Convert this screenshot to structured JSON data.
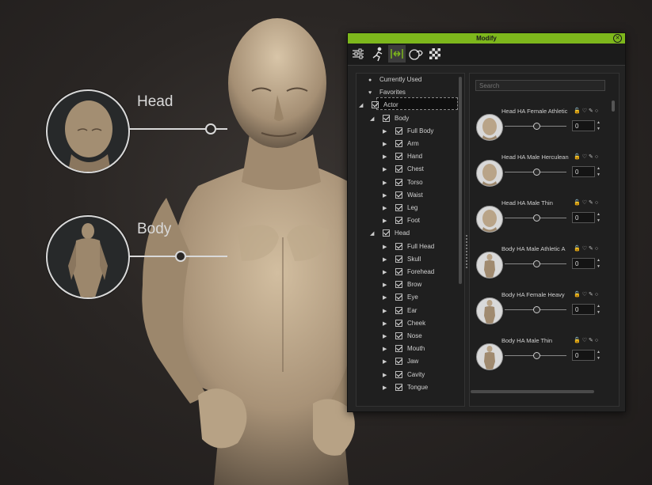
{
  "window": {
    "title": "Modify"
  },
  "toolbar": {
    "tools": [
      {
        "name": "sliders-icon",
        "active": false
      },
      {
        "name": "motion-icon",
        "active": false
      },
      {
        "name": "morph-icon",
        "active": true
      },
      {
        "name": "face-icon",
        "active": false
      },
      {
        "name": "checker-icon",
        "active": false
      }
    ]
  },
  "callouts": [
    {
      "label": "Head"
    },
    {
      "label": "Body"
    }
  ],
  "tree": {
    "items": [
      {
        "label": "Currently Used",
        "marker": "●",
        "indent": 0,
        "triangle": "",
        "checkbox": false
      },
      {
        "label": "Favorites",
        "marker": "♥",
        "indent": 0,
        "triangle": "",
        "checkbox": false
      },
      {
        "label": "Actor",
        "indent": 1,
        "triangle": "◢",
        "checkbox": true
      },
      {
        "label": "Body",
        "indent": 2,
        "triangle": "◢",
        "checkbox": true
      },
      {
        "label": "Full Body",
        "indent": 3,
        "triangle": "▶",
        "checkbox": true
      },
      {
        "label": "Arm",
        "indent": 3,
        "triangle": "▶",
        "checkbox": true
      },
      {
        "label": "Hand",
        "indent": 3,
        "triangle": "▶",
        "checkbox": true
      },
      {
        "label": "Chest",
        "indent": 3,
        "triangle": "▶",
        "checkbox": true
      },
      {
        "label": "Torso",
        "indent": 3,
        "triangle": "▶",
        "checkbox": true
      },
      {
        "label": "Waist",
        "indent": 3,
        "triangle": "▶",
        "checkbox": true
      },
      {
        "label": "Leg",
        "indent": 3,
        "triangle": "▶",
        "checkbox": true
      },
      {
        "label": "Foot",
        "indent": 3,
        "triangle": "▶",
        "checkbox": true
      },
      {
        "label": "Head",
        "indent": 2,
        "triangle": "◢",
        "checkbox": true
      },
      {
        "label": "Full Head",
        "indent": 3,
        "triangle": "▶",
        "checkbox": true
      },
      {
        "label": "Skull",
        "indent": 3,
        "triangle": "▶",
        "checkbox": true
      },
      {
        "label": "Forehead",
        "indent": 3,
        "triangle": "▶",
        "checkbox": true
      },
      {
        "label": "Brow",
        "indent": 3,
        "triangle": "▶",
        "checkbox": true
      },
      {
        "label": "Eye",
        "indent": 3,
        "triangle": "▶",
        "checkbox": true
      },
      {
        "label": "Ear",
        "indent": 3,
        "triangle": "▶",
        "checkbox": true
      },
      {
        "label": "Cheek",
        "indent": 3,
        "triangle": "▶",
        "checkbox": true
      },
      {
        "label": "Nose",
        "indent": 3,
        "triangle": "▶",
        "checkbox": true
      },
      {
        "label": "Mouth",
        "indent": 3,
        "triangle": "▶",
        "checkbox": true
      },
      {
        "label": "Jaw",
        "indent": 3,
        "triangle": "▶",
        "checkbox": true
      },
      {
        "label": "Cavity",
        "indent": 3,
        "triangle": "▶",
        "checkbox": true
      },
      {
        "label": "Tongue",
        "indent": 3,
        "triangle": "▶",
        "checkbox": true
      }
    ]
  },
  "search": {
    "placeholder": "Search"
  },
  "morphs": [
    {
      "name": "Head HA Female Athletic",
      "value": "0",
      "kind": "head"
    },
    {
      "name": "Head HA Male Herculean",
      "value": "0",
      "kind": "head"
    },
    {
      "name": "Head HA Male Thin",
      "value": "0",
      "kind": "head"
    },
    {
      "name": "Body HA Male Athletic A",
      "value": "0",
      "kind": "body"
    },
    {
      "name": "Body HA Female Heavy",
      "value": "0",
      "kind": "body"
    },
    {
      "name": "Body HA Male Thin",
      "value": "0",
      "kind": "body"
    }
  ],
  "morph_icons": "🔓♡✎○",
  "colors": {
    "titlebar": "#7db71c",
    "accent": "#7db71c",
    "skin": "#b9a488"
  }
}
